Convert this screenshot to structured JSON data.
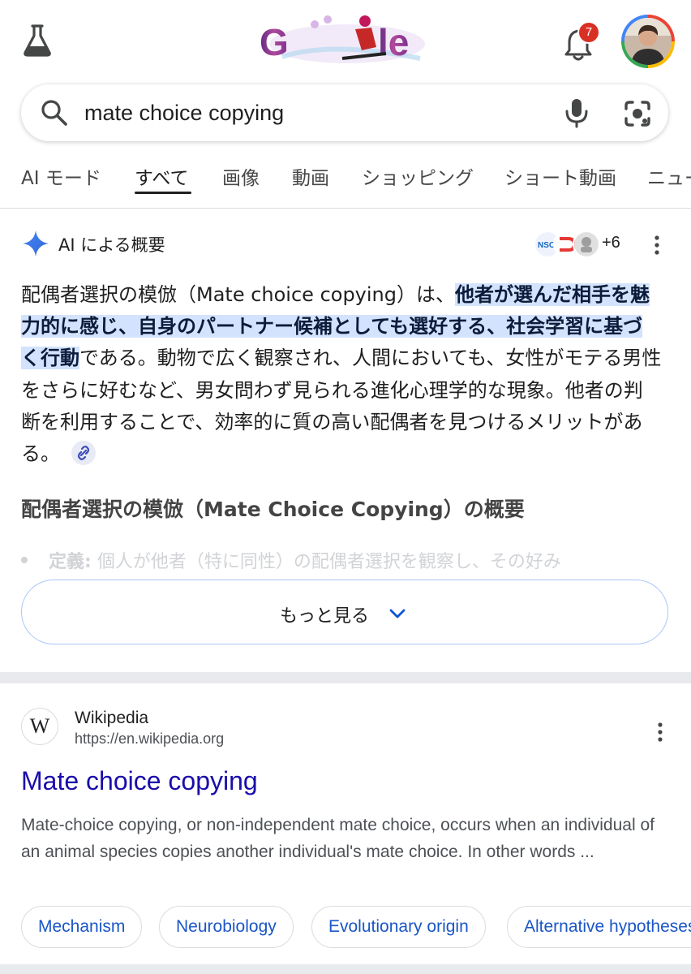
{
  "colors": {
    "highlight_bg": "#d3e3fd",
    "link_blue": "#1a0dab",
    "chip_text": "#1a56c6",
    "badge_red": "#d93025",
    "accent_blue": "#4285f4"
  },
  "header": {
    "labs_icon": "flask-icon",
    "logo": "google-doodle-logo",
    "logo_text": "Google",
    "notifications": {
      "icon": "bell-icon",
      "count": "7"
    },
    "avatar": "user-avatar"
  },
  "search": {
    "query": "mate choice copying",
    "icons": [
      "search-icon",
      "mic-icon",
      "lens-icon"
    ]
  },
  "tabs": [
    {
      "label": "AI モード",
      "active": false
    },
    {
      "label": "すべて",
      "active": true
    },
    {
      "label": "画像",
      "active": false
    },
    {
      "label": "動画",
      "active": false
    },
    {
      "label": "ショッピング",
      "active": false
    },
    {
      "label": "ショート動画",
      "active": false
    },
    {
      "label": "ニュー",
      "active": false
    }
  ],
  "ai_overview": {
    "title": "AI による概要",
    "source_count": "+6",
    "text_before": "配偶者選択の模倣（Mate choice copying）は、",
    "text_highlight": "他者が選んだ相手を魅力的に感じ、自身のパートナー候補としても選好する、社会学習に基づく行動",
    "text_after": "である。動物で広く観察され、人間においても、女性がモテる男性をさらに好むなど、男女問わず見られる進化心理学的な現象。他者の判断を利用することで、効率的に質の高い配偶者を見つけるメリットがある。",
    "subheading": "配偶者選択の模倣（Mate Choice Copying）の概要",
    "faded_bullet_label": "定義:",
    "faded_bullet_text": "個人が他者（特に同性）の配偶者選択を観察し、その好み",
    "more_label": "もっと見る"
  },
  "result": {
    "site_name": "Wikipedia",
    "site_icon_letter": "W",
    "url": "https://en.wikipedia.org",
    "title": "Mate choice copying",
    "snippet": "Mate-choice copying, or non-independent mate choice, occurs when an individual of an animal species copies another individual's mate choice. In other words ...",
    "chips": [
      "Mechanism",
      "Neurobiology",
      "Evolutionary origin",
      "Alternative hypotheses"
    ]
  }
}
